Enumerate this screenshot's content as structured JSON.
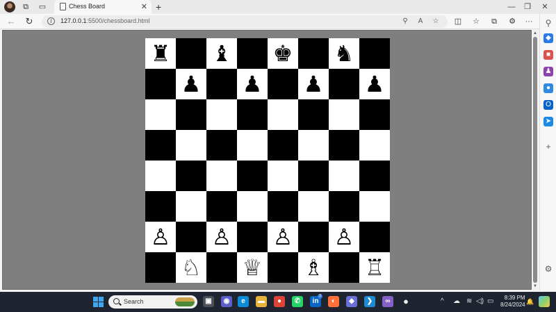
{
  "browser": {
    "tab": {
      "title": "Chess Board",
      "close_glyph": "✕"
    },
    "new_tab_glyph": "+",
    "window_controls": {
      "minimize": "—",
      "restore": "❐",
      "close": "✕"
    },
    "nav": {
      "back": "←",
      "refresh": "↻"
    },
    "address": {
      "host": "127.0.0.1",
      "rest": ":5500/chessboard.html"
    },
    "omnibox_icons": {
      "zoom": "⚲",
      "read_aloud": "A",
      "favorite": "☆"
    },
    "toolbar_icons": {
      "split": "◫",
      "favorites": "☆",
      "collections": "⧉",
      "extensions": "⚙",
      "more": "···",
      "copilot": "✦"
    }
  },
  "board": {
    "rows": [
      [
        "♜",
        "♞",
        "♝",
        "♛",
        "♚",
        "♝",
        "♞",
        "♜"
      ],
      [
        "♟",
        "♟",
        "♟",
        "♟",
        "♟",
        "♟",
        "♟",
        "♟"
      ],
      [
        "",
        "",
        "",
        "",
        "",
        "",
        "",
        ""
      ],
      [
        "",
        "",
        "",
        "",
        "",
        "",
        "",
        ""
      ],
      [
        "",
        "",
        "",
        "",
        "",
        "",
        "",
        ""
      ],
      [
        "",
        "",
        "",
        "",
        "",
        "",
        "",
        ""
      ],
      [
        "♙",
        "♙",
        "♙",
        "♙",
        "♙",
        "♙",
        "♙",
        "♙"
      ],
      [
        "♖",
        "♘",
        "♗",
        "♕",
        "♔",
        "♗",
        "♘",
        "♖"
      ]
    ]
  },
  "sidebar_icons": [
    {
      "name": "search",
      "glyph": "⚲",
      "color": "#5a5a5a"
    },
    {
      "name": "shopping",
      "glyph": "◆",
      "color": "#2c7be5"
    },
    {
      "name": "tools",
      "glyph": "■",
      "color": "#d9534f"
    },
    {
      "name": "games",
      "glyph": "♟",
      "color": "#8e44ad"
    },
    {
      "name": "m365",
      "glyph": "●",
      "color": "#2f8ae0"
    },
    {
      "name": "outlook",
      "glyph": "O",
      "color": "#0a64c8"
    },
    {
      "name": "send",
      "glyph": "➤",
      "color": "#1e88e5"
    },
    {
      "name": "add",
      "glyph": "+",
      "color": "#5a5a5a"
    },
    {
      "name": "settings",
      "glyph": "⚙",
      "color": "#5a5a5a"
    }
  ],
  "taskbar": {
    "search_label": "Search",
    "apps": [
      {
        "name": "task-view",
        "glyph": "▣",
        "color": "#4a4f58"
      },
      {
        "name": "meet",
        "glyph": "◉",
        "color": "#5b5fc7"
      },
      {
        "name": "edge",
        "glyph": "e",
        "color": "#0c8bd6"
      },
      {
        "name": "file-explorer",
        "glyph": "▬",
        "color": "#e8b33a"
      },
      {
        "name": "chrome",
        "glyph": "●",
        "color": "#db4437"
      },
      {
        "name": "whatsapp",
        "glyph": "✆",
        "color": "#25d366"
      },
      {
        "name": "linkedin",
        "glyph": "in",
        "color": "#0a66c2"
      },
      {
        "name": "firefox",
        "glyph": "◐",
        "color": "#ff7139"
      },
      {
        "name": "app-store",
        "glyph": "◆",
        "color": "#6a6fd6"
      },
      {
        "name": "vscode",
        "glyph": "❯",
        "color": "#1f8ad2"
      },
      {
        "name": "visual-studio",
        "glyph": "∞",
        "color": "#8661c5"
      },
      {
        "name": "github",
        "glyph": "●",
        "color": "#f0f0f0"
      }
    ],
    "linkedin_badge": "3",
    "tray": {
      "chevron": "^",
      "cloud": "☁",
      "wifi": "≋",
      "volume": "◁)",
      "battery": "▭"
    },
    "clock": {
      "time": "8:39 PM",
      "date": "8/24/2024"
    },
    "notifications": "🔔"
  }
}
